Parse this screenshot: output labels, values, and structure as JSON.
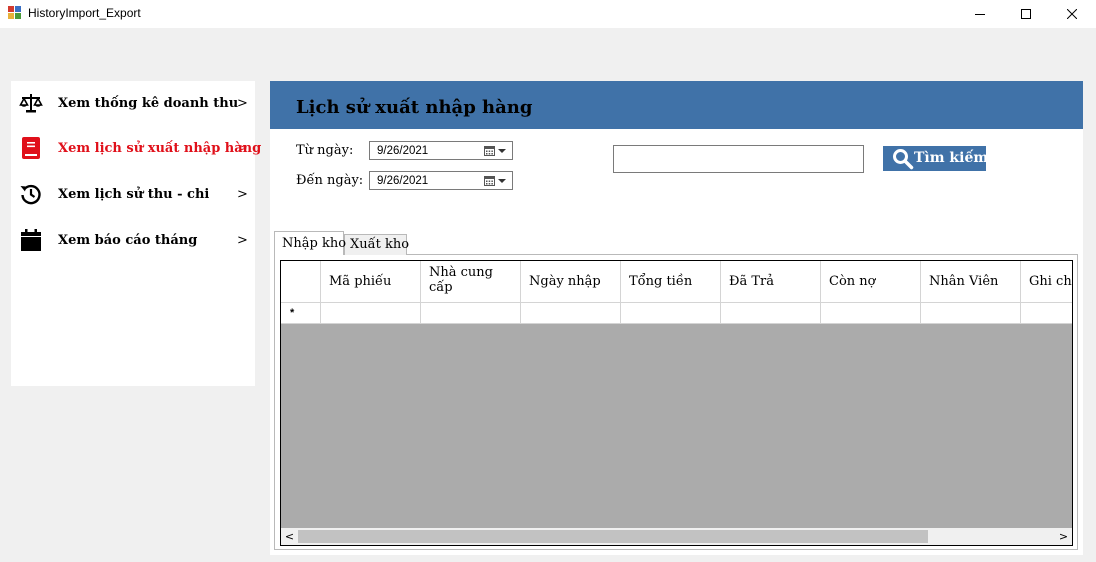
{
  "window": {
    "title": "HistoryImport_Export"
  },
  "sidebar": {
    "items": [
      {
        "label": "Xem thống kê doanh thu",
        "arrow": ">",
        "icon": "scale-icon",
        "active": false
      },
      {
        "label": "Xem lịch sử xuất nhập hàng",
        "arrow": ">",
        "icon": "book-icon",
        "active": true
      },
      {
        "label": "Xem lịch sử thu - chi",
        "arrow": ">",
        "icon": "history-icon",
        "active": false
      },
      {
        "label": "Xem báo cáo tháng",
        "arrow": ">",
        "icon": "calendar-icon",
        "active": false
      }
    ],
    "active_color": "#e0101a"
  },
  "main": {
    "header_title": "Lịch sử xuất nhập hàng",
    "header_color": "#4072a8",
    "from_label": "Từ ngày:",
    "from_value": "9/26/2021",
    "to_label": "Đến ngày:",
    "to_value": "9/26/2021",
    "search_value": "",
    "search_button": "Tìm kiếm",
    "tabs": [
      {
        "label": "Nhập kho",
        "active": true
      },
      {
        "label": "Xuất kho",
        "active": false
      }
    ],
    "grid": {
      "columns": [
        "Mã phiếu",
        "Nhà cung cấp",
        "Ngày nhập",
        "Tổng tiền",
        "Đã Trả",
        "Còn nợ",
        "Nhân Viên",
        "Ghi chú"
      ],
      "new_row_marker": "*"
    },
    "scroll_left": "<",
    "scroll_right": ">"
  }
}
